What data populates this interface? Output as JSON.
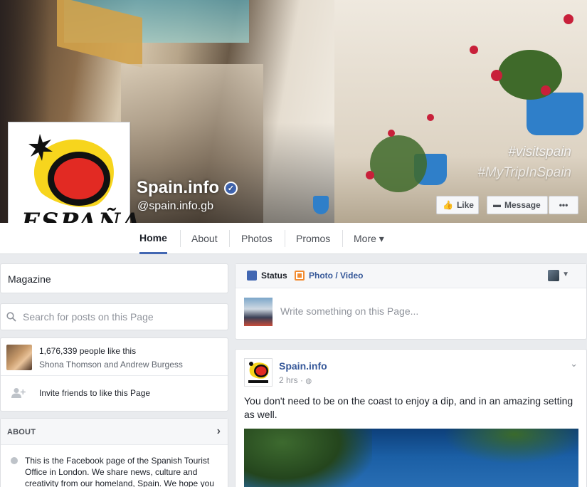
{
  "cover": {
    "tag_lines": [
      "#visitspain",
      "#MyTripInSpain"
    ]
  },
  "page": {
    "name": "Spain.info",
    "handle": "@spain.info.gb",
    "logo_text": "ESPAÑA"
  },
  "cover_actions": {
    "like_label": "Like",
    "message_label": "Message",
    "more_label": "•••"
  },
  "nav": {
    "tabs": [
      {
        "label": "Home",
        "active": true
      },
      {
        "label": "About"
      },
      {
        "label": "Photos"
      },
      {
        "label": "Promos"
      },
      {
        "label": "More ▾"
      }
    ]
  },
  "sidebar": {
    "magazine_label": "Magazine",
    "search_placeholder": "Search for posts on this Page",
    "likes_count": "1,676,339 people like this",
    "likes_friends": "Shona Thomson and Andrew Burgess",
    "invite_label": "Invite friends to like this Page",
    "about_title": "ABOUT",
    "about_text": "This is the Facebook page of the Spanish Tourist Office in London. We share news, culture and creativity from our homeland, Spain. We hope you"
  },
  "composer": {
    "status_label": "Status",
    "photo_label": "Photo / Video",
    "placeholder": "Write something on this Page..."
  },
  "post": {
    "author": "Spain.info",
    "time": "2 hrs · ",
    "text": "You don't need to be on the coast to enjoy a dip, and in an amazing setting as well."
  },
  "colors": {
    "brand_blue": "#4267b2",
    "link_blue": "#365899",
    "background": "#e9ebee"
  }
}
